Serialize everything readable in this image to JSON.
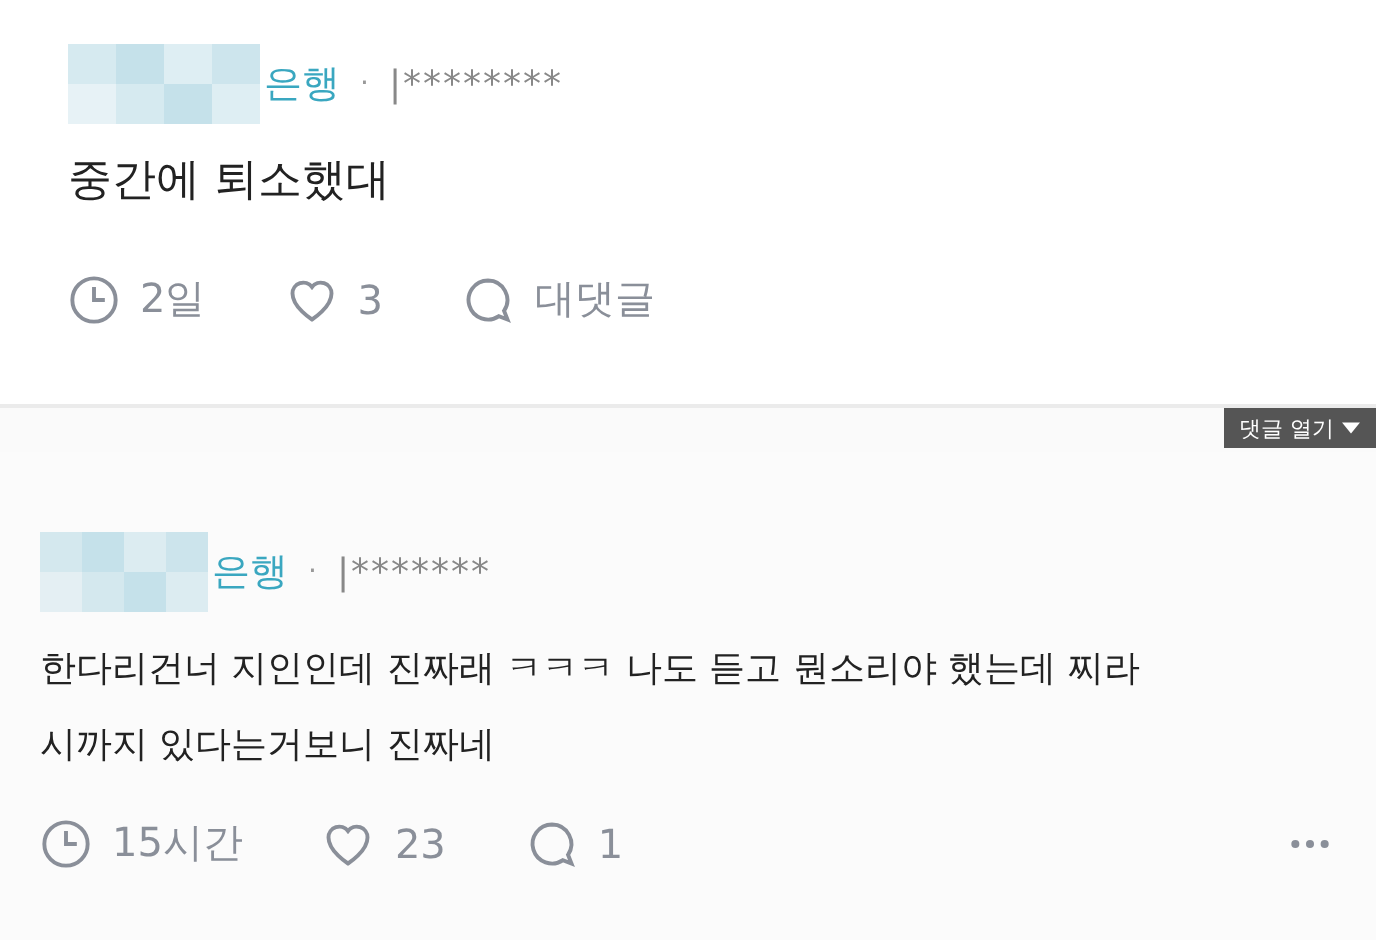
{
  "posts": [
    {
      "author_suffix": "은행",
      "separator": "·",
      "masked_id": "|********",
      "body": "중간에 퇴소했대",
      "time": "2일",
      "likes": "3",
      "replies": "대댓글",
      "has_more": false
    },
    {
      "author_suffix": "은행",
      "separator": "·",
      "masked_id": "|*******",
      "body": "한다리건너 지인인데 진짜래 ㅋㅋㅋ 나도 듣고 뭔소리야 했는데 찌라시까지 있다는거보니 진짜네",
      "time": "15시간",
      "likes": "23",
      "replies": "1",
      "has_more": true
    }
  ],
  "open_comments_button": "댓글 열기"
}
